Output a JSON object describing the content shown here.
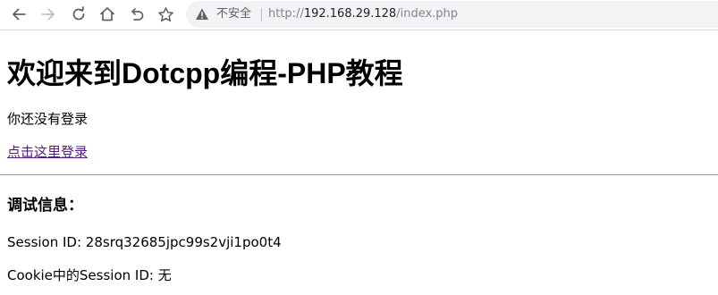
{
  "browser": {
    "security_label": "不安全",
    "url_scheme": "http://",
    "url_host": "192.168.29.128",
    "url_path": "/index.php"
  },
  "page": {
    "heading": "欢迎来到Dotcpp编程-PHP教程",
    "status_text": "你还没有登录",
    "login_link": "点击这里登录",
    "debug_heading": "调试信息：",
    "session_id_line": "Session ID: 28srq32685jpc99s2vji1po0t4",
    "cookie_session_line": "Cookie中的Session ID: 无"
  },
  "colors": {
    "link_visited": "#551a8b",
    "toolbar_icon": "#5f6368",
    "omnibox_bg": "#f1f3f4"
  },
  "icons": {
    "back": "arrow-left-icon",
    "forward": "arrow-right-icon",
    "reload": "reload-icon",
    "home": "home-icon",
    "undo": "undo-icon",
    "bookmark": "star-icon",
    "security": "warning-triangle-icon"
  }
}
